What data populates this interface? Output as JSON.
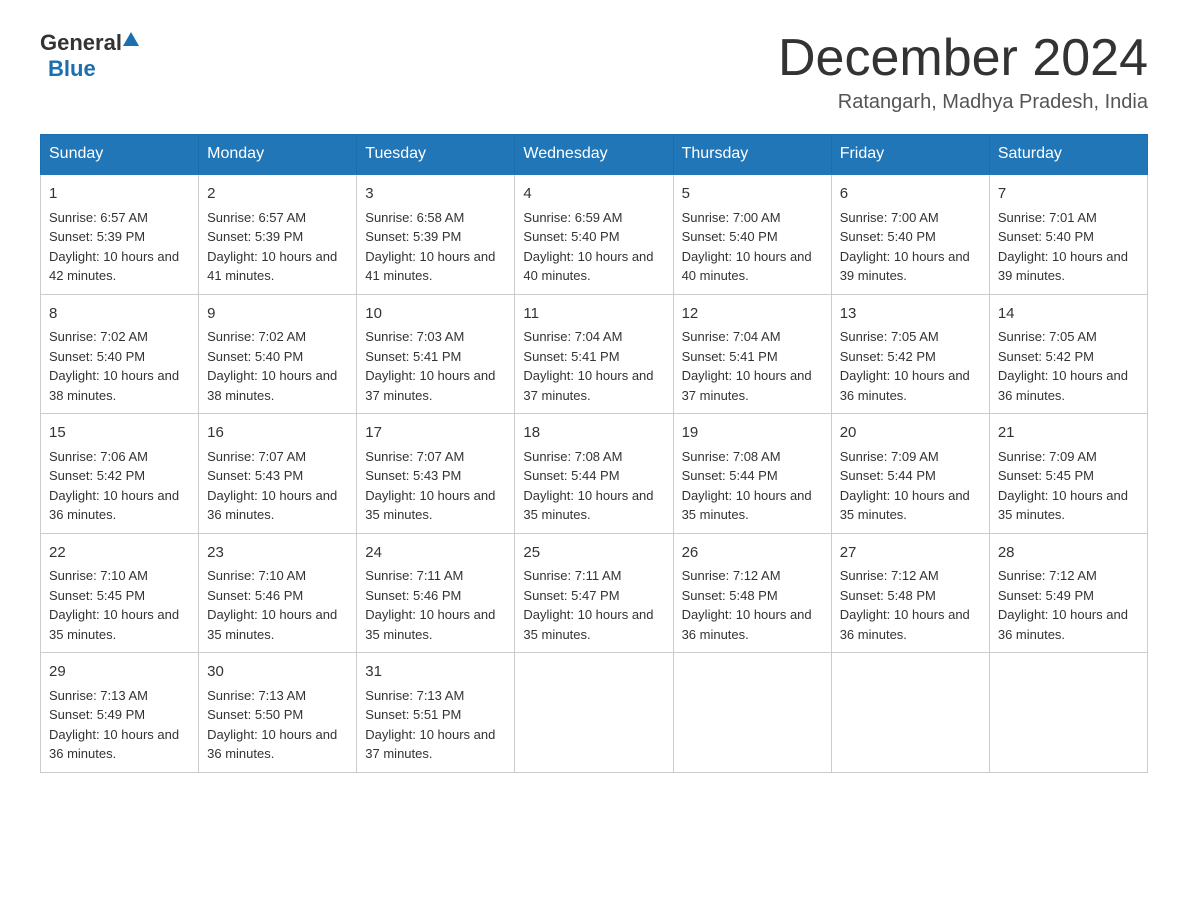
{
  "header": {
    "logo_general": "General",
    "logo_blue": "Blue",
    "month_year": "December 2024",
    "location": "Ratangarh, Madhya Pradesh, India"
  },
  "days_of_week": [
    "Sunday",
    "Monday",
    "Tuesday",
    "Wednesday",
    "Thursday",
    "Friday",
    "Saturday"
  ],
  "weeks": [
    [
      {
        "day": "1",
        "sunrise": "6:57 AM",
        "sunset": "5:39 PM",
        "daylight": "10 hours and 42 minutes."
      },
      {
        "day": "2",
        "sunrise": "6:57 AM",
        "sunset": "5:39 PM",
        "daylight": "10 hours and 41 minutes."
      },
      {
        "day": "3",
        "sunrise": "6:58 AM",
        "sunset": "5:39 PM",
        "daylight": "10 hours and 41 minutes."
      },
      {
        "day": "4",
        "sunrise": "6:59 AM",
        "sunset": "5:40 PM",
        "daylight": "10 hours and 40 minutes."
      },
      {
        "day": "5",
        "sunrise": "7:00 AM",
        "sunset": "5:40 PM",
        "daylight": "10 hours and 40 minutes."
      },
      {
        "day": "6",
        "sunrise": "7:00 AM",
        "sunset": "5:40 PM",
        "daylight": "10 hours and 39 minutes."
      },
      {
        "day": "7",
        "sunrise": "7:01 AM",
        "sunset": "5:40 PM",
        "daylight": "10 hours and 39 minutes."
      }
    ],
    [
      {
        "day": "8",
        "sunrise": "7:02 AM",
        "sunset": "5:40 PM",
        "daylight": "10 hours and 38 minutes."
      },
      {
        "day": "9",
        "sunrise": "7:02 AM",
        "sunset": "5:40 PM",
        "daylight": "10 hours and 38 minutes."
      },
      {
        "day": "10",
        "sunrise": "7:03 AM",
        "sunset": "5:41 PM",
        "daylight": "10 hours and 37 minutes."
      },
      {
        "day": "11",
        "sunrise": "7:04 AM",
        "sunset": "5:41 PM",
        "daylight": "10 hours and 37 minutes."
      },
      {
        "day": "12",
        "sunrise": "7:04 AM",
        "sunset": "5:41 PM",
        "daylight": "10 hours and 37 minutes."
      },
      {
        "day": "13",
        "sunrise": "7:05 AM",
        "sunset": "5:42 PM",
        "daylight": "10 hours and 36 minutes."
      },
      {
        "day": "14",
        "sunrise": "7:05 AM",
        "sunset": "5:42 PM",
        "daylight": "10 hours and 36 minutes."
      }
    ],
    [
      {
        "day": "15",
        "sunrise": "7:06 AM",
        "sunset": "5:42 PM",
        "daylight": "10 hours and 36 minutes."
      },
      {
        "day": "16",
        "sunrise": "7:07 AM",
        "sunset": "5:43 PM",
        "daylight": "10 hours and 36 minutes."
      },
      {
        "day": "17",
        "sunrise": "7:07 AM",
        "sunset": "5:43 PM",
        "daylight": "10 hours and 35 minutes."
      },
      {
        "day": "18",
        "sunrise": "7:08 AM",
        "sunset": "5:44 PM",
        "daylight": "10 hours and 35 minutes."
      },
      {
        "day": "19",
        "sunrise": "7:08 AM",
        "sunset": "5:44 PM",
        "daylight": "10 hours and 35 minutes."
      },
      {
        "day": "20",
        "sunrise": "7:09 AM",
        "sunset": "5:44 PM",
        "daylight": "10 hours and 35 minutes."
      },
      {
        "day": "21",
        "sunrise": "7:09 AM",
        "sunset": "5:45 PM",
        "daylight": "10 hours and 35 minutes."
      }
    ],
    [
      {
        "day": "22",
        "sunrise": "7:10 AM",
        "sunset": "5:45 PM",
        "daylight": "10 hours and 35 minutes."
      },
      {
        "day": "23",
        "sunrise": "7:10 AM",
        "sunset": "5:46 PM",
        "daylight": "10 hours and 35 minutes."
      },
      {
        "day": "24",
        "sunrise": "7:11 AM",
        "sunset": "5:46 PM",
        "daylight": "10 hours and 35 minutes."
      },
      {
        "day": "25",
        "sunrise": "7:11 AM",
        "sunset": "5:47 PM",
        "daylight": "10 hours and 35 minutes."
      },
      {
        "day": "26",
        "sunrise": "7:12 AM",
        "sunset": "5:48 PM",
        "daylight": "10 hours and 36 minutes."
      },
      {
        "day": "27",
        "sunrise": "7:12 AM",
        "sunset": "5:48 PM",
        "daylight": "10 hours and 36 minutes."
      },
      {
        "day": "28",
        "sunrise": "7:12 AM",
        "sunset": "5:49 PM",
        "daylight": "10 hours and 36 minutes."
      }
    ],
    [
      {
        "day": "29",
        "sunrise": "7:13 AM",
        "sunset": "5:49 PM",
        "daylight": "10 hours and 36 minutes."
      },
      {
        "day": "30",
        "sunrise": "7:13 AM",
        "sunset": "5:50 PM",
        "daylight": "10 hours and 36 minutes."
      },
      {
        "day": "31",
        "sunrise": "7:13 AM",
        "sunset": "5:51 PM",
        "daylight": "10 hours and 37 minutes."
      },
      null,
      null,
      null,
      null
    ]
  ]
}
